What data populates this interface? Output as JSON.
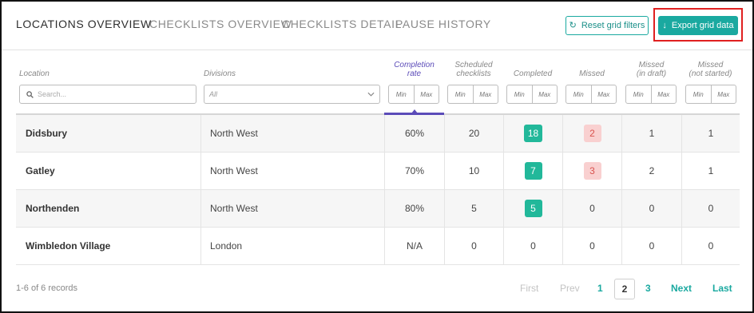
{
  "tabs": [
    {
      "label": "LOCATIONS OVERVIEW",
      "active": true
    },
    {
      "label": "CHECKLISTS OVERVIEW",
      "active": false
    },
    {
      "label": "CHECKLISTS DETAIL",
      "active": false
    },
    {
      "label": "PAUSE HISTORY",
      "active": false
    }
  ],
  "toolbar": {
    "reset_label": "Reset grid filters",
    "reset_icon": "refresh-icon",
    "export_label": "Export grid data",
    "export_icon": "download-arrow-icon"
  },
  "columns": {
    "location": "Location",
    "divisions": "Divisions",
    "completion_rate": [
      "Completion",
      "rate"
    ],
    "scheduled": [
      "Scheduled",
      "checklists"
    ],
    "completed": "Completed",
    "missed": "Missed",
    "missed_draft": [
      "Missed",
      "(in draft)"
    ],
    "missed_not_started": [
      "Missed",
      "(not started)"
    ]
  },
  "filters": {
    "search_placeholder": "Search...",
    "divisions_selected": "All",
    "min_label": "Min",
    "max_label": "Max"
  },
  "rows": [
    {
      "location": "Didsbury",
      "division": "North West",
      "completion_rate": "60%",
      "scheduled": "20",
      "completed": "18",
      "missed": "2",
      "missed_draft": "1",
      "missed_not_started": "1"
    },
    {
      "location": "Gatley",
      "division": "North West",
      "completion_rate": "70%",
      "scheduled": "10",
      "completed": "7",
      "missed": "3",
      "missed_draft": "2",
      "missed_not_started": "1"
    },
    {
      "location": "Northenden",
      "division": "North West",
      "completion_rate": "80%",
      "scheduled": "5",
      "completed": "5",
      "missed": "0",
      "missed_draft": "0",
      "missed_not_started": "0"
    },
    {
      "location": "Wimbledon Village",
      "division": "London",
      "completion_rate": "N/A",
      "scheduled": "0",
      "completed": "0",
      "missed": "0",
      "missed_draft": "0",
      "missed_not_started": "0"
    }
  ],
  "footer": {
    "records": "1-6 of 6 records",
    "first": "First",
    "prev": "Prev",
    "pages": [
      "1",
      "2",
      "3"
    ],
    "current_page": "2",
    "next": "Next",
    "last": "Last"
  },
  "colors": {
    "accent": "#1aa9a0",
    "sort_accent": "#5b4bb8",
    "completed_badge": "#22b89a",
    "missed_badge": "#f9d0d0",
    "highlight_box": "#e02020"
  }
}
